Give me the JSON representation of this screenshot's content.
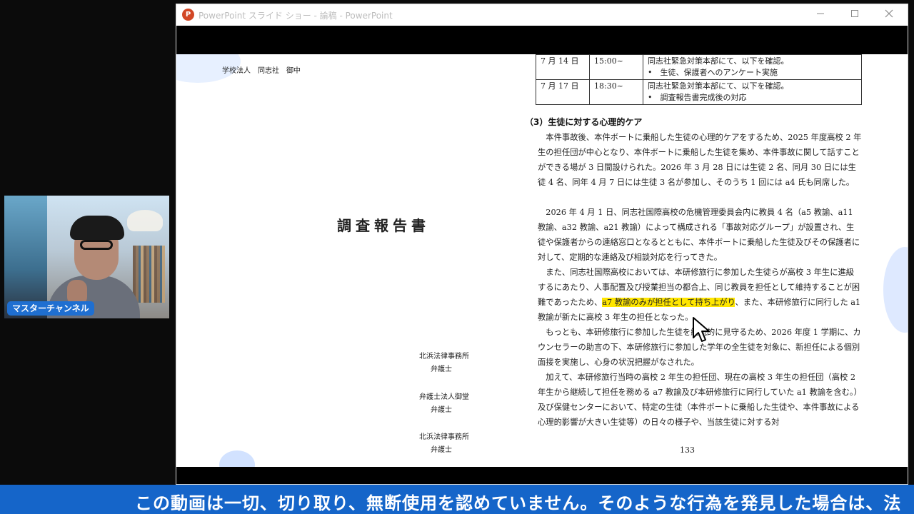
{
  "webcam": {
    "label": "マスターチャンネル"
  },
  "window": {
    "title": "PowerPoint スライド ショー - 論稿 - PowerPoint",
    "minimize_icon": "minimize-icon",
    "maximize_icon": "maximize-icon",
    "close_icon": "close-icon"
  },
  "left_page": {
    "addressee": "学校法人　同志社　御中",
    "title": "調査報告書",
    "signatures": [
      {
        "firm": "北浜法律事務所",
        "role": "弁護士"
      },
      {
        "firm": "弁護士法人御堂",
        "role": "弁護士"
      },
      {
        "firm": "北浜法律事務所",
        "role": "弁護士"
      }
    ]
  },
  "right_page": {
    "table": [
      {
        "date": "7 月 14 日",
        "time": "15:00~",
        "lines": [
          "同志社緊急対策本部にて、以下を確認。",
          "•　生徒、保護者へのアンケート実施"
        ]
      },
      {
        "date": "7 月 17 日",
        "time": "18:30~",
        "lines": [
          "同志社緊急対策本部にて、以下を確認。",
          "•　調査報告書完成後の対応"
        ]
      }
    ],
    "section_heading": "（3）生徒に対する心理的ケア",
    "paragraphs": {
      "p1": "　本件事故後、本件ボートに乗船した生徒の心理的ケアをするため、2025 年度高校 2 年生の担任団が中心となり、本件ボートに乗船した生徒を集め、本件事故に関して話すことができる場が 3 日間設けられた。2026 年 3 月 28 日には生徒 2 名、同月 30 日には生徒 4 名、同年 4 月 7 日には生徒 3 名が参加し、そのうち 1 回には a4 氏も同席した。",
      "p2": "　2026 年 4 月 1 日、同志社国際高校の危機管理委員会内に教員 4 名（a5 教諭、a11 教諭、a32 教諭、a21 教諭）によって構成される「事故対応グループ」が設置され、生徒や保護者からの連絡窓口となるとともに、本件ボートに乗船した生徒及びその保護者に対して、定期的な連絡及び相談対応を行ってきた。",
      "p3_before": "　また、同志社国際高校においては、本研修旅行に参加した生徒らが高校 3 年生に進級するにあたり、人事配置及び授業担当の都合上、同じ教員を担任として維持することが困難であったため、",
      "p3_highlight": "a7 教諭のみが担任として持ち上がり",
      "p3_after": "、また、本研修旅行に同行した a1 教諭が新たに高校 3 年生の担任となった。",
      "p4": "　もっとも、本研修旅行に参加した生徒を継続的に見守るため、2026 年度 1 学期に、カウンセラーの助言の下、本研修旅行に参加した学年の全生徒を対象に、新担任による個別面接を実施し、心身の状況把握がなされた。",
      "p5": "　加えて、本研修旅行当時の高校 2 年生の担任団、現在の高校 3 年生の担任団（高校 2 年生から継続して担任を務める a7 教諭及び本研修旅行に同行していた a1 教諭を含む。）及び保健センターにおいて、特定の生徒（本件ボートに乗船した生徒や、本件事故による心理的影響が大きい生徒等）の日々の様子や、当該生徒に対する対"
    },
    "page_number": "133"
  },
  "cursor_icon": "mouse-pointer-icon",
  "ticker": {
    "text": "この動画は一切、切り取り、無断使用を認めていません。そのような行為を発見した場合は、法"
  }
}
